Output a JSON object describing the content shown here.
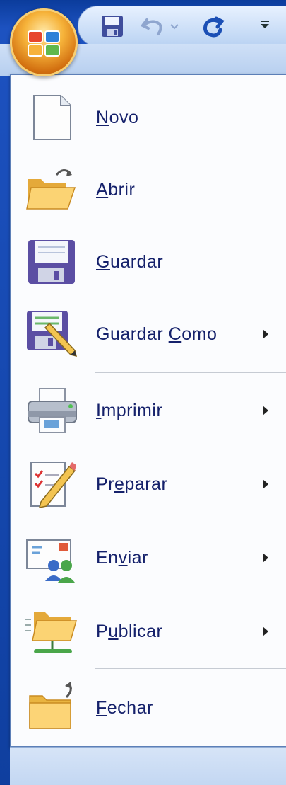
{
  "office_button": {
    "icon": "office-logo-icon"
  },
  "quick_access": {
    "save_icon": "floppy-save-icon",
    "undo_icon": "undo-icon",
    "undo_dropdown_icon": "chevron-down-icon",
    "redo_icon": "redo-icon",
    "customize_icon": "customize-dropdown-icon"
  },
  "menu": {
    "items": [
      {
        "label_pre": "",
        "label_key": "N",
        "label_post": "ovo",
        "icon": "new-document-icon",
        "has_submenu": false
      },
      {
        "label_pre": "",
        "label_key": "A",
        "label_post": "brir",
        "icon": "open-folder-icon",
        "has_submenu": false
      },
      {
        "label_pre": "",
        "label_key": "G",
        "label_post": "uardar",
        "icon": "save-floppy-icon",
        "has_submenu": false
      },
      {
        "label_pre": "Guardar ",
        "label_key": "C",
        "label_post": "omo",
        "icon": "save-as-icon",
        "has_submenu": true
      },
      {
        "label_pre": "",
        "label_key": "I",
        "label_post": "mprimir",
        "icon": "printer-icon",
        "has_submenu": true
      },
      {
        "label_pre": "Pr",
        "label_key": "e",
        "label_post": "parar",
        "icon": "prepare-checklist-icon",
        "has_submenu": true
      },
      {
        "label_pre": "En",
        "label_key": "v",
        "label_post": "iar",
        "icon": "send-email-icon",
        "has_submenu": true
      },
      {
        "label_pre": "P",
        "label_key": "u",
        "label_post": "blicar",
        "icon": "publish-folder-icon",
        "has_submenu": true
      },
      {
        "label_pre": "",
        "label_key": "F",
        "label_post": "echar",
        "icon": "close-folder-icon",
        "has_submenu": false
      }
    ]
  },
  "colors": {
    "label_text": "#15216b",
    "menu_background": "#fbfcfe",
    "frame_blue": "#1d52c0"
  }
}
